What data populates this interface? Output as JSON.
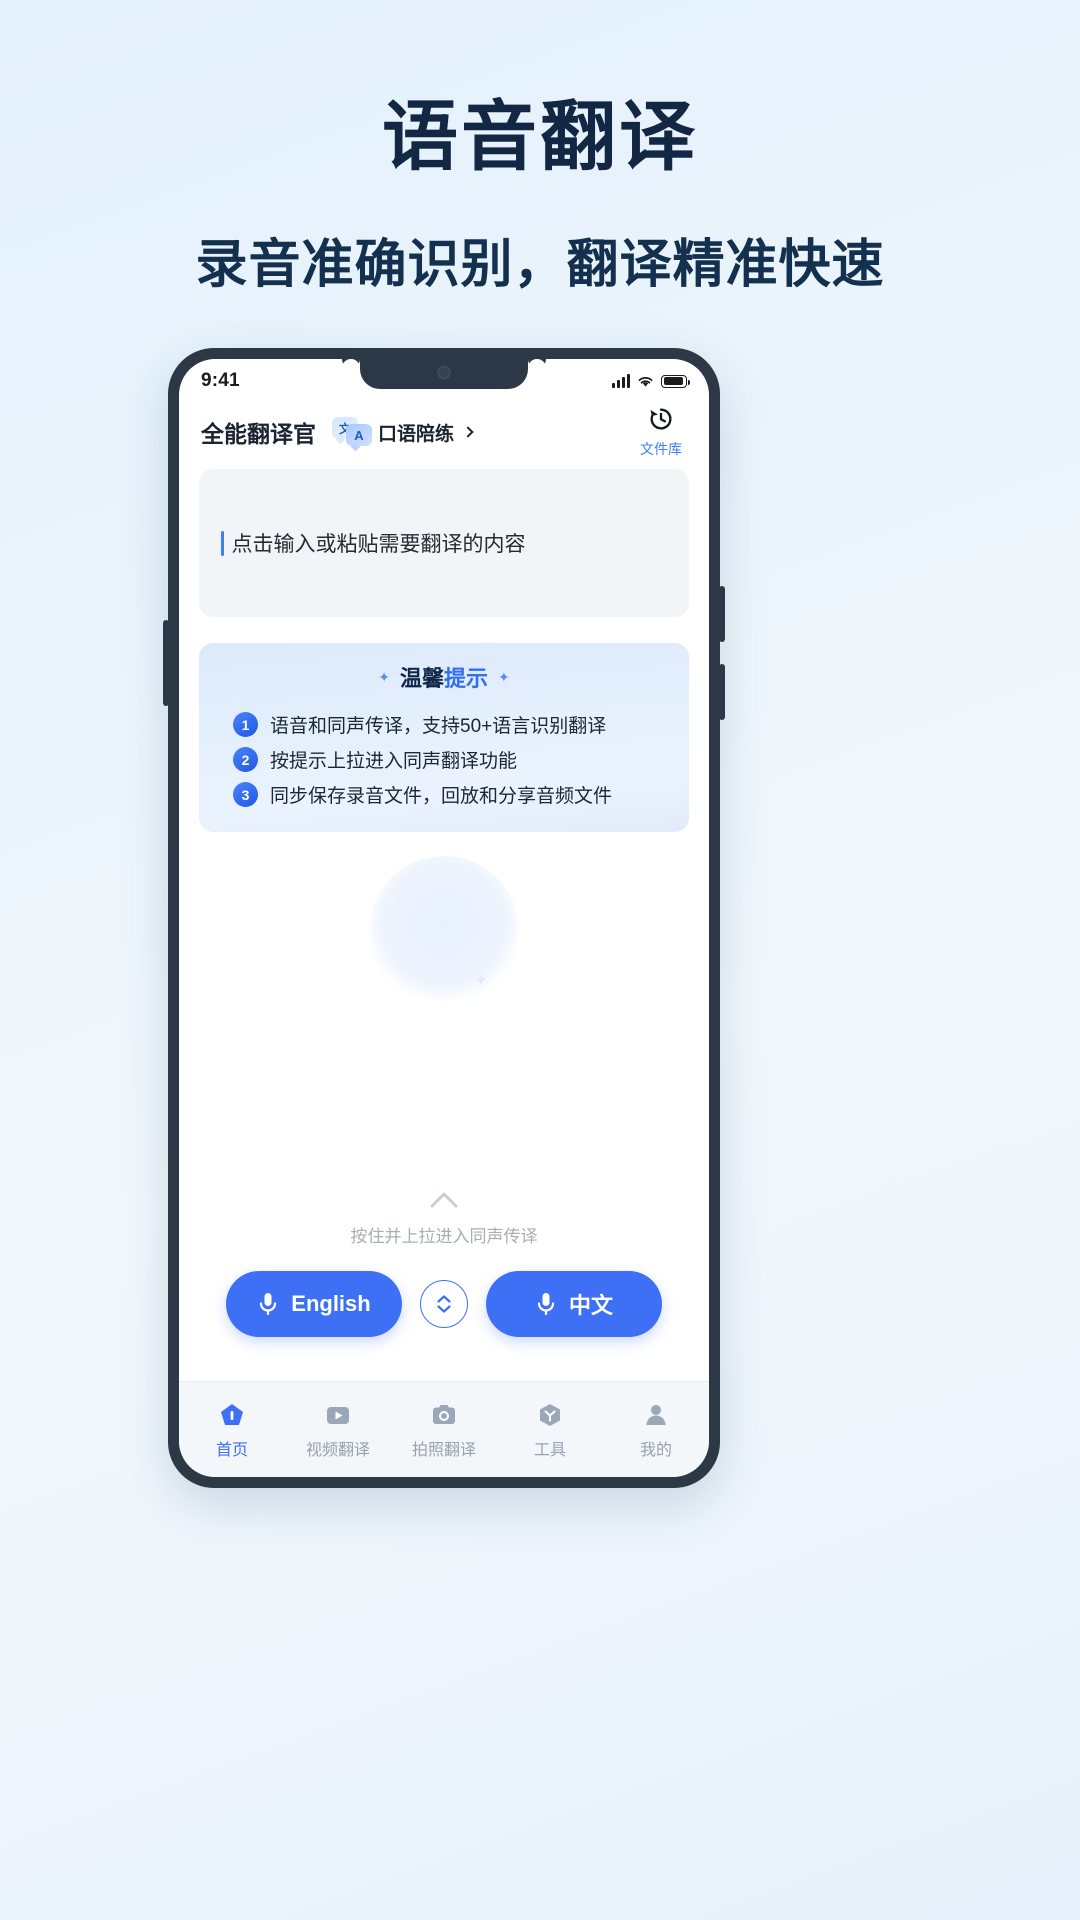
{
  "promo": {
    "title": "语音翻译",
    "subtitle": "录音准确识别，翻译精准快速"
  },
  "status_bar": {
    "time": "9:41",
    "signal_icon": "cellular-signal-icon",
    "wifi_icon": "wifi-icon",
    "battery_icon": "battery-icon"
  },
  "app_header": {
    "app_title": "全能翻译官",
    "bubble_icon_cn": "文",
    "bubble_icon_en": "A",
    "practice_label": "口语陪练",
    "chevron": "›",
    "file_library_label": "文件库",
    "file_library_icon": "history-clock-icon"
  },
  "input_card": {
    "placeholder": "点击输入或粘贴需要翻译的内容"
  },
  "tips": {
    "heading_part1": "温馨",
    "heading_part2": "提示",
    "sparkle": "✦",
    "items": [
      {
        "num": "1",
        "text": "语音和同声传译，支持50+语言识别翻译"
      },
      {
        "num": "2",
        "text": "按提示上拉进入同声翻译功能"
      },
      {
        "num": "3",
        "text": "同步保存录音文件，回放和分享音频文件"
      }
    ]
  },
  "illustration": {
    "name": "speaker-sparkle-illustration"
  },
  "pull_hint": {
    "text": "按住并上拉进入同声传译",
    "icon": "chevron-up-icon"
  },
  "mic_row": {
    "left_label": "English",
    "right_label": "中文",
    "swap_icon": "swap-vertical-icon",
    "mic_icon": "microphone-icon"
  },
  "bottom_nav": {
    "items": [
      {
        "label": "首页",
        "icon": "home-icon",
        "active": true
      },
      {
        "label": "视频翻译",
        "icon": "video-icon",
        "active": false
      },
      {
        "label": "拍照翻译",
        "icon": "camera-icon",
        "active": false
      },
      {
        "label": "工具",
        "icon": "toolbox-cube-icon",
        "active": false
      },
      {
        "label": "我的",
        "icon": "person-icon",
        "active": false
      }
    ]
  },
  "colors": {
    "accent_blue": "#3e70f5",
    "title_navy": "#122744",
    "phone_frame": "#2d3846",
    "nav_inactive": "#97a2b2",
    "page_bg_top": "#e4f0fb"
  }
}
